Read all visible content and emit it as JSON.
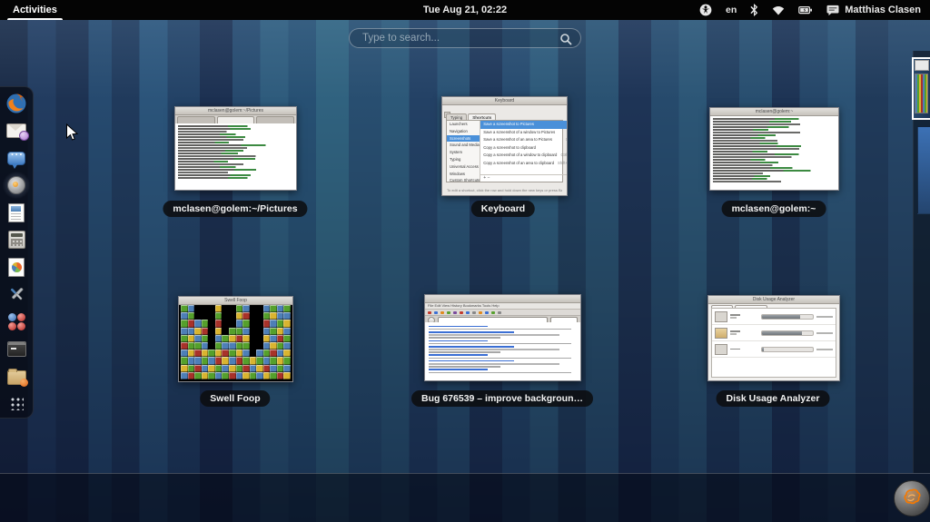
{
  "topbar": {
    "activities": "Activities",
    "clock": "Tue Aug 21, 02:22",
    "keyboard_layout": "en",
    "user_name": "Matthias Clasen",
    "status_icons": [
      "accessibility-icon",
      "keyboard-layout",
      "bluetooth-icon",
      "wifi-icon",
      "battery-icon",
      "chat-icon"
    ]
  },
  "search": {
    "placeholder": "Type to search..."
  },
  "dock": {
    "items": [
      "firefox",
      "evolution",
      "empathy",
      "rhythmbox",
      "libreoffice-writer",
      "calculator",
      "disk-usage-analyzer",
      "tweak-tool",
      "swell-foop",
      "terminal",
      "files",
      "show-applications"
    ]
  },
  "windows": {
    "terminal_pictures": {
      "label": "mclasen@golem:~/Pictures",
      "title": "mclasen@golem:~/Pictures"
    },
    "keyboard": {
      "label": "Keyboard",
      "title": "Keyboard",
      "tabs": [
        "Typing",
        "Shortcuts"
      ],
      "sidebar": [
        "Launchers",
        "Navigation",
        "Screenshots",
        "Sound and Media",
        "System",
        "Typing",
        "Universal Access",
        "Windows",
        "Custom Shortcuts"
      ],
      "selected_sidebar": "Screenshots",
      "shortcuts": [
        {
          "action": "Save a screenshot to Pictures",
          "binding": "Print"
        },
        {
          "action": "Save a screenshot of a window to Pictures",
          "binding": "Alt+Print"
        },
        {
          "action": "Save a screenshot of an area to Pictures",
          "binding": "Shift+Print"
        },
        {
          "action": "Copy a screenshot to clipboard",
          "binding": "Ctrl+Print"
        },
        {
          "action": "Copy a screenshot of a window to clipboard",
          "binding": "Ctrl+Alt+Print"
        },
        {
          "action": "Copy a screenshot of an area to clipboard",
          "binding": "Shift+Ctrl+Print"
        }
      ],
      "add_remove": "+  −",
      "hint": "To edit a shortcut, click the row and hold down the new keys or press Backspace to clear."
    },
    "terminal_home": {
      "label": "mclasen@golem:~",
      "title": "mclasen@golem:~"
    },
    "swell_foop": {
      "label": "Swell Foop",
      "title": "Swell Foop",
      "colors": {
        "G": "#55a02c",
        "B": "#4e7fb7",
        "Y": "#d9b430",
        "R": "#a8322a",
        "K": "#000000"
      },
      "grid": [
        "GBKKKYKKGBKKBGBG",
        "BGKKKGKKYRKKGYBB",
        "GRBGKRKKBGKKRBGY",
        "BBYRKYKGGBKKBGYB",
        "GYBGKBGYRYKKYBRG",
        "RGGBKGBBGGKKBYGB",
        "BYRYGYRGYBKBGRBY",
        "GBBGBRYBRGYGBGYG",
        "YGRBYGBYGRBYRBGB",
        "BRGYGBGRBYGBYGRY"
      ]
    },
    "browser": {
      "label": "Bug 676539 – improve backgroun…",
      "menu": "File  Edit  View  History  Bookmarks  Tools  Help"
    },
    "disk_usage": {
      "label": "Disk Usage Analyzer",
      "title": "Disk Usage Analyzer"
    }
  },
  "workspaces": {
    "count": 2,
    "active_index": 0
  },
  "colors": {
    "selection": "#4a90d9",
    "label_bg": "#0c0e10",
    "accent_orange": "#f57900"
  }
}
